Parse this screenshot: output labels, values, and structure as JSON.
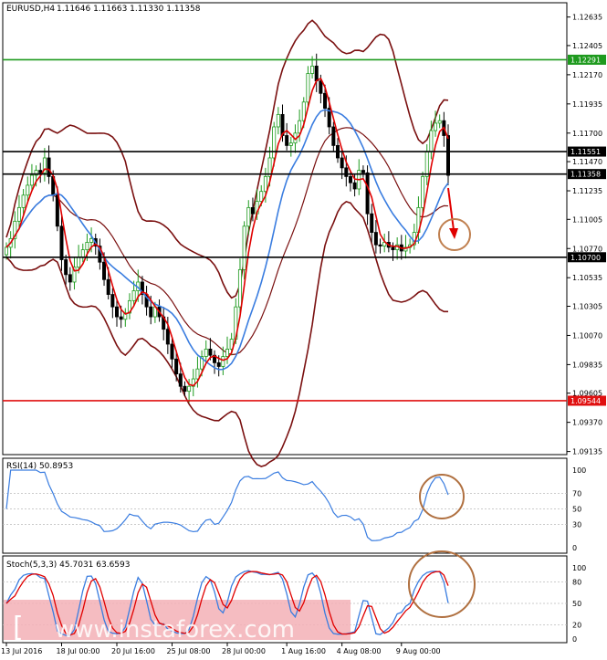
{
  "header": {
    "symbol": "EURUSD,H4",
    "ohlc": "1.11646 1.11663 1.11330 1.11358"
  },
  "price_axis": {
    "ticks": [
      "1.12635",
      "1.12405",
      "1.12170",
      "1.11935",
      "1.11700",
      "1.11470",
      "1.11235",
      "1.11005",
      "1.10770",
      "1.10535",
      "1.10305",
      "1.10070",
      "1.09835",
      "1.09605",
      "1.09370",
      "1.09135"
    ]
  },
  "levels": [
    {
      "price": 1.12291,
      "label": "1.12291",
      "color": "#1e9a1e"
    },
    {
      "price": 1.11551,
      "label": "1.11551",
      "color": "#000000"
    },
    {
      "price": 1.1137,
      "label": "1.11358",
      "color": "#000000"
    },
    {
      "price": 1.107,
      "label": "1.10700",
      "color": "#000000"
    },
    {
      "price": 1.09544,
      "label": "1.09544",
      "color": "#e01010"
    }
  ],
  "rsi": {
    "title": "RSI(14) 50.8953",
    "ticks": [
      "100",
      "70",
      "50",
      "30",
      "0"
    ]
  },
  "stoch": {
    "title": "Stoch(5,3,3) 45.7031 63.6593",
    "ticks": [
      "100",
      "80",
      "50",
      "20",
      "0"
    ]
  },
  "time_axis": [
    "13 Jul 2016",
    "18 Jul 00:00",
    "20 Jul 16:00",
    "25 Jul 08:00",
    "28 Jul 00:00",
    "1 Aug 16:00",
    "4 Aug 08:00",
    "9 Aug 00:00"
  ],
  "watermark": "www.instaforex.com",
  "colors": {
    "bull": "#1e9a1e",
    "bear": "#000000",
    "ma_fast": "#e00000",
    "ma_slow": "#3a7de0",
    "bands": "#7a1010",
    "annot": "#b07040",
    "arrow": "#e00000"
  },
  "chart_data": {
    "type": "candlestick",
    "symbol": "EURUSD",
    "timeframe": "H4",
    "ylim": [
      1.0911,
      1.1275
    ],
    "close": [
      1.1078,
      1.1085,
      1.1099,
      1.111,
      1.112,
      1.1128,
      1.1136,
      1.114,
      1.1138,
      1.115,
      1.1135,
      1.112,
      1.1095,
      1.1068,
      1.1056,
      1.105,
      1.1062,
      1.107,
      1.1076,
      1.1082,
      1.1085,
      1.1079,
      1.1066,
      1.1052,
      1.104,
      1.103,
      1.1022,
      1.102,
      1.1025,
      1.1035,
      1.1043,
      1.105,
      1.104,
      1.103,
      1.1022,
      1.103,
      1.1022,
      1.1012,
      1.1,
      1.0988,
      1.0976,
      1.0966,
      1.0962,
      1.0966,
      1.0972,
      1.098,
      1.099,
      1.0996,
      1.0991,
      1.0985,
      1.0982,
      1.099,
      1.0996,
      1.1004,
      1.103,
      1.106,
      1.1095,
      1.111,
      1.1105,
      1.1115,
      1.1123,
      1.1135,
      1.115,
      1.1175,
      1.1185,
      1.1168,
      1.116,
      1.1162,
      1.117,
      1.118,
      1.1195,
      1.1218,
      1.1224,
      1.1212,
      1.1202,
      1.119,
      1.1175,
      1.116,
      1.115,
      1.1142,
      1.1135,
      1.113,
      1.1125,
      1.114,
      1.1138,
      1.1105,
      1.109,
      1.108,
      1.1079,
      1.1082,
      1.1078,
      1.1076,
      1.108,
      1.1075,
      1.1078,
      1.108,
      1.109,
      1.111,
      1.1135,
      1.1155,
      1.1172,
      1.1178,
      1.118,
      1.1168,
      1.1136
    ]
  }
}
